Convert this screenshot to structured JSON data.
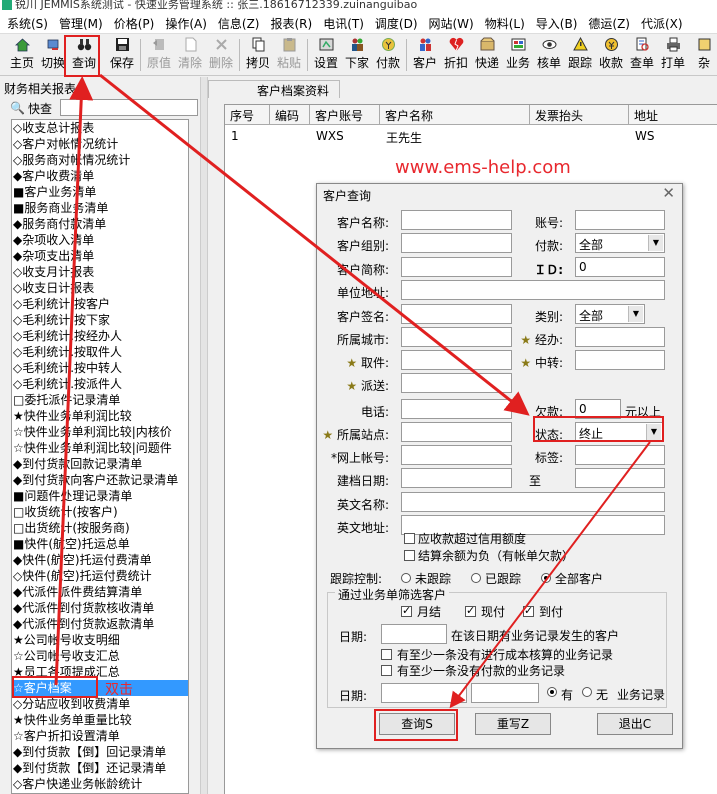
{
  "title_bar": "锐川 JEMMIS系统测试 - 快速业务管理系统 :: 张三.18616712339.zuinanguibao",
  "menu": [
    "系统(S)",
    "管理(M)",
    "价格(P)",
    "操作(A)",
    "信息(Z)",
    "报表(R)",
    "电讯(T)",
    "调度(D)",
    "网站(W)",
    "物料(L)",
    "导入(B)",
    "德运(Z)",
    "代派(X)"
  ],
  "toolbar": {
    "main": "主页",
    "switch": "切换",
    "query": "查询",
    "save": "保存",
    "orig": "原值",
    "clear": "清除",
    "delete": "删除",
    "copy": "拷贝",
    "paste": "粘贴",
    "settings": "设置",
    "download": "下家",
    "payment": "付款",
    "customer": "客户",
    "discount": "折扣",
    "express": "快递",
    "business": "业务",
    "verify": "核单",
    "track": "跟踪",
    "collect": "收款",
    "check_bill": "查单",
    "print_bill": "打单",
    "misc": "杂"
  },
  "sidebar": {
    "title": "财务相关报表",
    "search_label": "快查",
    "items": [
      "◇收支总计报表",
      "◇客户对帐情况统计",
      "◇服务商对帐情况统计",
      "◆客户收费清单",
      "■客户业务清单",
      "■服务商业务清单",
      "◆服务商付款清单",
      "◆杂项收入清单",
      "◆杂项支出清单",
      "◇收支月计报表",
      "◇收支日计报表",
      "◇毛利统计.按客户",
      "◇毛利统计.按下家",
      "◇毛利统计.按经办人",
      "◇毛利统计.按取件人",
      "◇毛利统计.按中转人",
      "◇毛利统计.按派件人",
      "□委托派件记录清单",
      "★快件业务单利润比较",
      "☆快件业务单利润比较|内核价",
      "☆快件业务单利润比较|问题件",
      "◆到付货款回款记录清单",
      "◆到付货款向客户还款记录清单",
      "■问题件处理记录清单",
      "□收货统计(按客户)",
      "□出货统计(按服务商)",
      "■快件(航空)托运总单",
      "◆快件(航空)托运付费清单",
      "◇快件(航空)托运付费统计",
      "◆代派件派件费结算清单",
      "◆代派件到付货款核收清单",
      "◆代派件到付货款返款清单",
      "★公司帐号收支明细",
      "☆公司帐号收支汇总",
      "★员工各项提成汇总",
      "☆客户档案",
      "◇分站应收到收费清单",
      "★快件业务单重量比较",
      "☆客户折扣设置清单",
      "◆到付货款【倒】回记录清单",
      "◆到付货款【倒】还记录清单",
      "◇客户快递业务帐龄统计"
    ],
    "selected_index": 35
  },
  "double_click_note": "双击",
  "tab": "客户档案资料",
  "grid": {
    "headers": [
      "序号",
      "编码",
      "客户账号",
      "客户名称",
      "发票抬头",
      "地址"
    ],
    "rows": [
      [
        "1",
        "",
        "WXS",
        "王先生",
        "",
        "WS"
      ]
    ]
  },
  "watermark": "www.ems-help.com",
  "dialog": {
    "title": "客户查询",
    "close": "✕",
    "name": "客户名称:",
    "account": "账号:",
    "group": "客户组别:",
    "payment": "付款:",
    "payment_value": "全部",
    "short_name": "客户简称:",
    "id_label": "ＩＤ:",
    "id_value": "0",
    "address": "单位地址:",
    "sign_name": "客户签名:",
    "category": "类别:",
    "category_value": "全部",
    "city": "所属城市:",
    "handler": "经办:",
    "pickup": "取件:",
    "transfer": "中转:",
    "delivery": "派送:",
    "phone": "电话:",
    "debt": "欠款:",
    "debt_value": "0",
    "debt_unit": "元以上",
    "station": "所属站点:",
    "status": "状态:",
    "status_value": "终止",
    "web_account": "*网上帐号:",
    "tag": "标签:",
    "date_created": "建档日期:",
    "to": "至",
    "en_name": "英文名称:",
    "en_address": "英文地址:",
    "over_credit": "应收款超过信用额度",
    "negative_balance": "结算余额为负（有帐单欠款）",
    "track_label": "跟踪控制:",
    "track_options": [
      "未跟踪",
      "已跟踪",
      "全部客户"
    ],
    "track_selected": 2,
    "group_title": "通过业务单筛选客户",
    "monthly": "月结",
    "cash": "现付",
    "cod": "到付",
    "date1": "日期:",
    "date1_note": "在该日期有业务记录发生的客户",
    "unverified": "有至少一条没有进行成本核算的业务记录",
    "unpaid": "有至少一条没有付款的业务记录",
    "date2": "日期:",
    "has": "有",
    "none": "无",
    "biz_record": "业务记录",
    "btn_query": "查询S",
    "btn_reset": "重写Z",
    "btn_exit": "退出C"
  }
}
